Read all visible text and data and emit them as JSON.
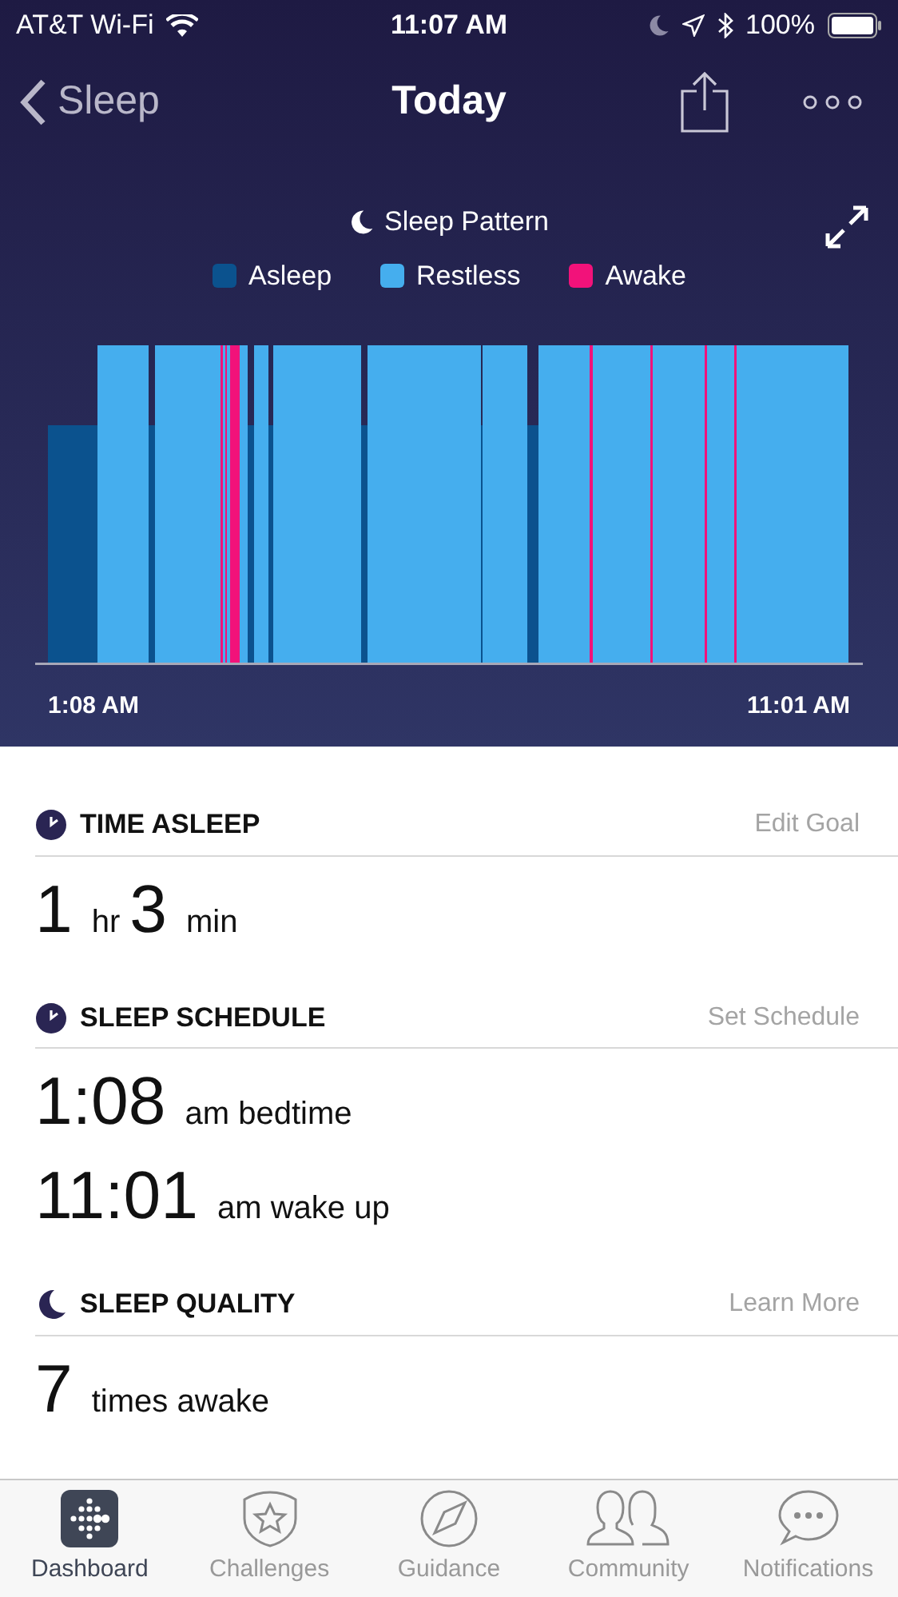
{
  "status_bar": {
    "carrier": "AT&T Wi-Fi",
    "time": "11:07 AM",
    "battery": "100%"
  },
  "nav": {
    "back": "Sleep",
    "title": "Today"
  },
  "chart": {
    "title": "Sleep Pattern",
    "legend": [
      {
        "label": "Asleep",
        "color": "#0b528e"
      },
      {
        "label": "Restless",
        "color": "#45aeee"
      },
      {
        "label": "Awake",
        "color": "#f2127a"
      }
    ],
    "start": "1:08 AM",
    "end": "11:01 AM"
  },
  "sections": [
    {
      "kind": "duration",
      "title": "TIME ASLEEP",
      "link": "Edit Goal",
      "rows": [
        [
          {
            "big": "1"
          },
          {
            "small": "hr"
          },
          {
            "big": "3"
          },
          {
            "small": "min"
          }
        ]
      ]
    },
    {
      "kind": "schedule",
      "title": "SLEEP SCHEDULE",
      "link": "Set Schedule",
      "rows": [
        [
          {
            "big": "1:08"
          },
          {
            "small": "am bedtime"
          }
        ],
        [
          {
            "big": "11:01"
          },
          {
            "small": "am wake up"
          }
        ]
      ]
    },
    {
      "kind": "quality",
      "title": "SLEEP QUALITY",
      "link": "Learn More",
      "rows": [
        [
          {
            "big": "7"
          },
          {
            "small": "times awake"
          }
        ]
      ]
    }
  ],
  "tabs": [
    {
      "label": "Dashboard",
      "selected": true
    },
    {
      "label": "Challenges",
      "selected": false
    },
    {
      "label": "Guidance",
      "selected": false
    },
    {
      "label": "Community",
      "selected": false
    },
    {
      "label": "Notifications",
      "selected": false
    }
  ]
}
